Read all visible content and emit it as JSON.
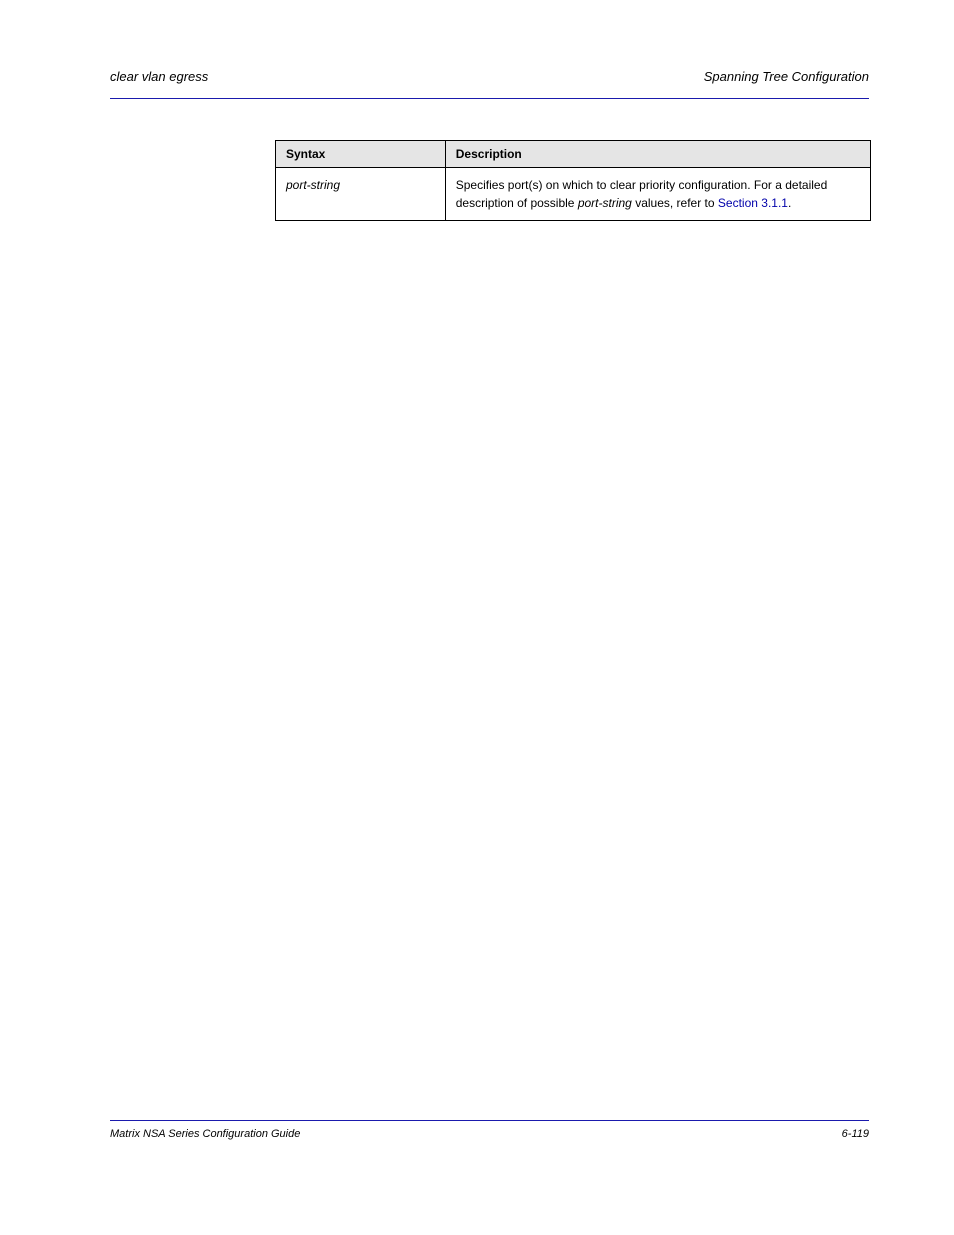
{
  "header": {
    "left": "clear vlan egress",
    "right": "Spanning Tree Configuration"
  },
  "table": {
    "columns": [
      "Syntax",
      "Description"
    ],
    "rows": [
      {
        "syntax": "port-string",
        "description": "Specifies port(s) on which to clear priority configuration. For a detailed description of possible port-string values, refer to Section 3.1.1."
      }
    ]
  },
  "footer": {
    "left": "Matrix NSA Series Configuration Guide",
    "right": "6-119"
  },
  "refs": {
    "section_link": "Section 3.1.1"
  }
}
